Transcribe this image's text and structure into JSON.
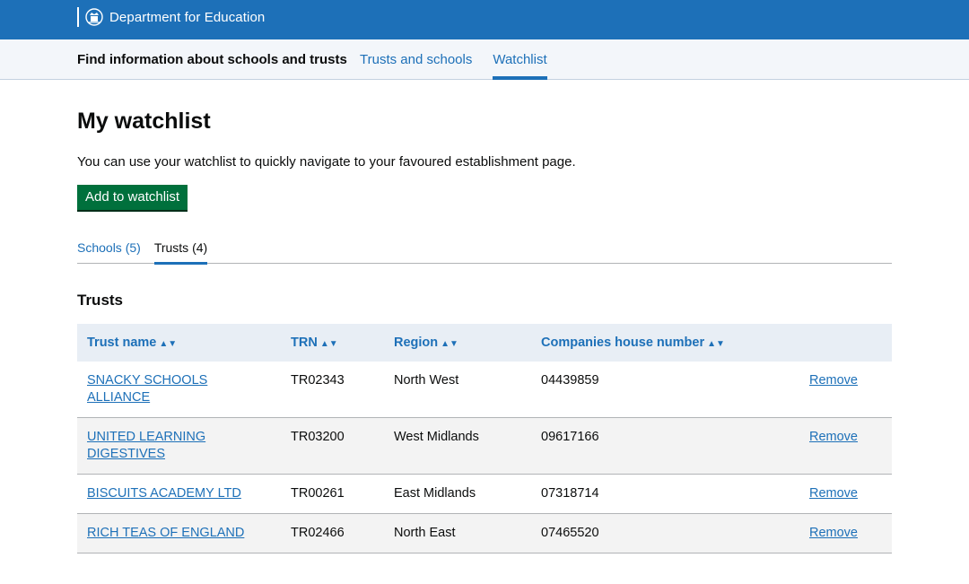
{
  "header": {
    "brand": "Department for Education",
    "crest_icon": "royal-crest-icon",
    "background": "#1d70b8"
  },
  "service": {
    "name": "Find information about schools and trusts",
    "nav": [
      {
        "label": "Trusts and schools",
        "active": false
      },
      {
        "label": "Watchlist",
        "active": true
      }
    ]
  },
  "page": {
    "title": "My watchlist",
    "intro": "You can use your watchlist to quickly navigate to your favoured establishment page.",
    "add_button": "Add to watchlist",
    "tabs": [
      {
        "label": "Schools (5)",
        "active": false
      },
      {
        "label": "Trusts (4)",
        "active": true
      }
    ],
    "section_title": "Trusts"
  },
  "table": {
    "columns": [
      "Trust name",
      "TRN",
      "Region",
      "Companies house number"
    ],
    "sort_icon": "sort-arrows-icon",
    "rows": [
      {
        "name_line1": "SNACKY SCHOOLS",
        "name_line2": "ALLIANCE",
        "trn": "TR02343",
        "region": "North West",
        "chn": "04439859",
        "action": "Remove"
      },
      {
        "name_line1": "UNITED LEARNING",
        "name_line2": "DIGESTIVES",
        "trn": "TR03200",
        "region": "West Midlands",
        "chn": "09617166",
        "action": "Remove"
      },
      {
        "name_line1": "BISCUITS ACADEMY LTD",
        "name_line2": "",
        "trn": "TR00261",
        "region": "East Midlands",
        "chn": "07318714",
        "action": "Remove"
      },
      {
        "name_line1": "RICH TEAS OF ENGLAND",
        "name_line2": "",
        "trn": "TR02466",
        "region": "North East",
        "chn": "07465520",
        "action": "Remove"
      }
    ]
  }
}
